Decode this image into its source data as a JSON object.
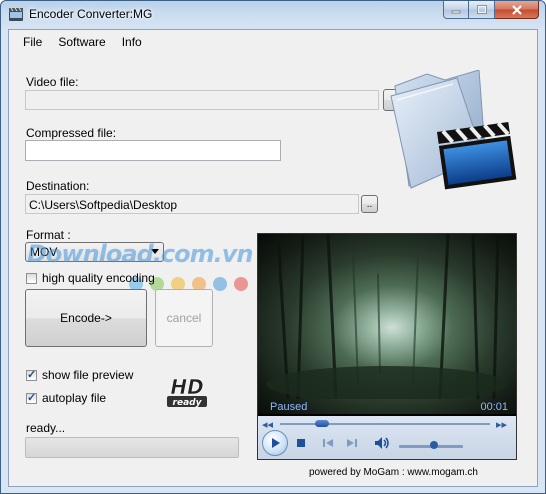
{
  "window": {
    "title": "Encoder Converter:MG",
    "controls": {
      "minimize": "—",
      "maximize": "□",
      "close": "✕"
    }
  },
  "menu": {
    "items": [
      "File",
      "Software",
      "Info"
    ]
  },
  "video_file": {
    "label": "Video file:",
    "value": ""
  },
  "browse": {
    "label": "Browse..."
  },
  "compressed_file": {
    "label": "Compressed file:",
    "value": ""
  },
  "destination": {
    "label": "Destination:",
    "value": "C:\\Users\\Softpedia\\Desktop",
    "button_label": ".."
  },
  "format": {
    "label": "Format :",
    "selected": "MOV"
  },
  "high_quality": {
    "label": "high quality encoding",
    "checked": false
  },
  "encode": {
    "label": "Encode->"
  },
  "cancel": {
    "label": "cancel"
  },
  "show_preview": {
    "label": "show file preview",
    "checked": true
  },
  "autoplay": {
    "label": "autoplay file",
    "checked": true
  },
  "hd_logo": {
    "top": "HD",
    "bottom": "ready"
  },
  "status": {
    "text": "ready...",
    "progress": 0
  },
  "player": {
    "state": "Paused",
    "time": "00:01",
    "seek_fraction": 0.2,
    "volume_fraction": 0.55
  },
  "footer": {
    "text": "powered by MoGam : www.mogam.ch"
  },
  "watermark": {
    "text": "Download.com.vn",
    "dot_colors": [
      "#5bb4e6",
      "#8ac85b",
      "#f2b93b",
      "#f2a24a",
      "#5aa0d8",
      "#e65a5a"
    ]
  },
  "colors": {
    "accent": "#2f5d9c",
    "player_status": "#8fb7ff"
  }
}
